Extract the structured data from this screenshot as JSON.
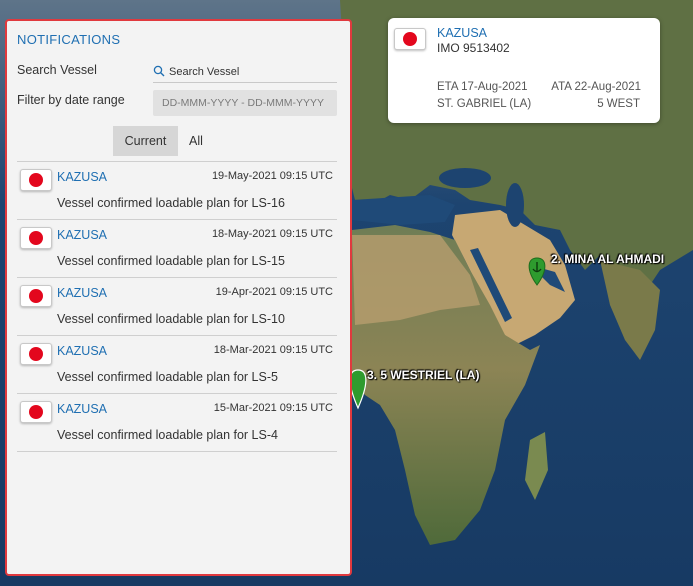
{
  "panel": {
    "title": "NOTIFICATIONS",
    "search_label": "Search Vessel",
    "search_placeholder": "Search Vessel",
    "date_label": "Filter by date range",
    "date_placeholder": "DD-MMM-YYYY - DD-MMM-YYYY",
    "tabs": [
      {
        "label": "Current",
        "active": true
      },
      {
        "label": "All",
        "active": false
      }
    ]
  },
  "notifications": [
    {
      "vessel": "KAZUSA",
      "timestamp": "19-May-2021 09:15 UTC",
      "message": "Vessel confirmed loadable plan for LS-16"
    },
    {
      "vessel": "KAZUSA",
      "timestamp": "18-May-2021 09:15 UTC",
      "message": "Vessel confirmed loadable plan for LS-15"
    },
    {
      "vessel": "KAZUSA",
      "timestamp": "19-Apr-2021 09:15 UTC",
      "message": "Vessel confirmed loadable plan for LS-10"
    },
    {
      "vessel": "KAZUSA",
      "timestamp": "18-Mar-2021 09:15 UTC",
      "message": "Vessel confirmed loadable plan for LS-5"
    },
    {
      "vessel": "KAZUSA",
      "timestamp": "15-Mar-2021 09:15 UTC",
      "message": "Vessel confirmed loadable plan for LS-4"
    }
  ],
  "vessel_card": {
    "name": "KAZUSA",
    "imo": "IMO 9513402",
    "eta": "ETA 17-Aug-2021",
    "ata": "ATA 22-Aug-2021",
    "port": "ST. GABRIEL (LA)",
    "direction": "5 WEST"
  },
  "map_pins": [
    {
      "label": "2. MINA AL AHMADI",
      "color": "#2e9b2e"
    },
    {
      "label": "3. 5 WESTRIEL (LA)",
      "color": "#2e9b2e"
    }
  ],
  "colors": {
    "accent": "#1f6fb2",
    "panel_border": "#e0393e",
    "flag_red": "#e3071d",
    "pin_green": "#2e9b2e"
  }
}
